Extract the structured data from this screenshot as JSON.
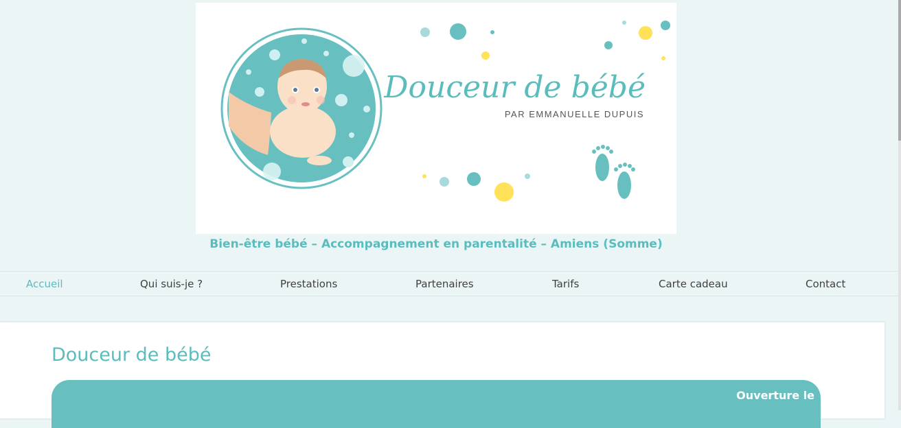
{
  "header": {
    "logo": {
      "title": "Douceur de bébé",
      "subtitle": "PAR EMMANUELLE DUPUIS",
      "illustration_icon": "baby-massage-illustration",
      "footprints_icon": "baby-footprints-icon"
    },
    "tagline": "Bien-être bébé – Accompagnement en parentalité – Amiens (Somme)"
  },
  "nav": {
    "items": [
      {
        "label": "Accueil",
        "active": true
      },
      {
        "label": "Qui suis-je ?"
      },
      {
        "label": "Prestations"
      },
      {
        "label": "Partenaires"
      },
      {
        "label": "Tarifs"
      },
      {
        "label": "Carte cadeau"
      },
      {
        "label": "Contact"
      }
    ]
  },
  "main": {
    "title": "Douceur de bébé",
    "announcement": "Ouverture le"
  },
  "colors": {
    "accent": "#5bbcbd",
    "announcement_bg": "#67c0bf",
    "page_bg": "#ecf5f6",
    "dot_yellow": "#ffe15a"
  }
}
